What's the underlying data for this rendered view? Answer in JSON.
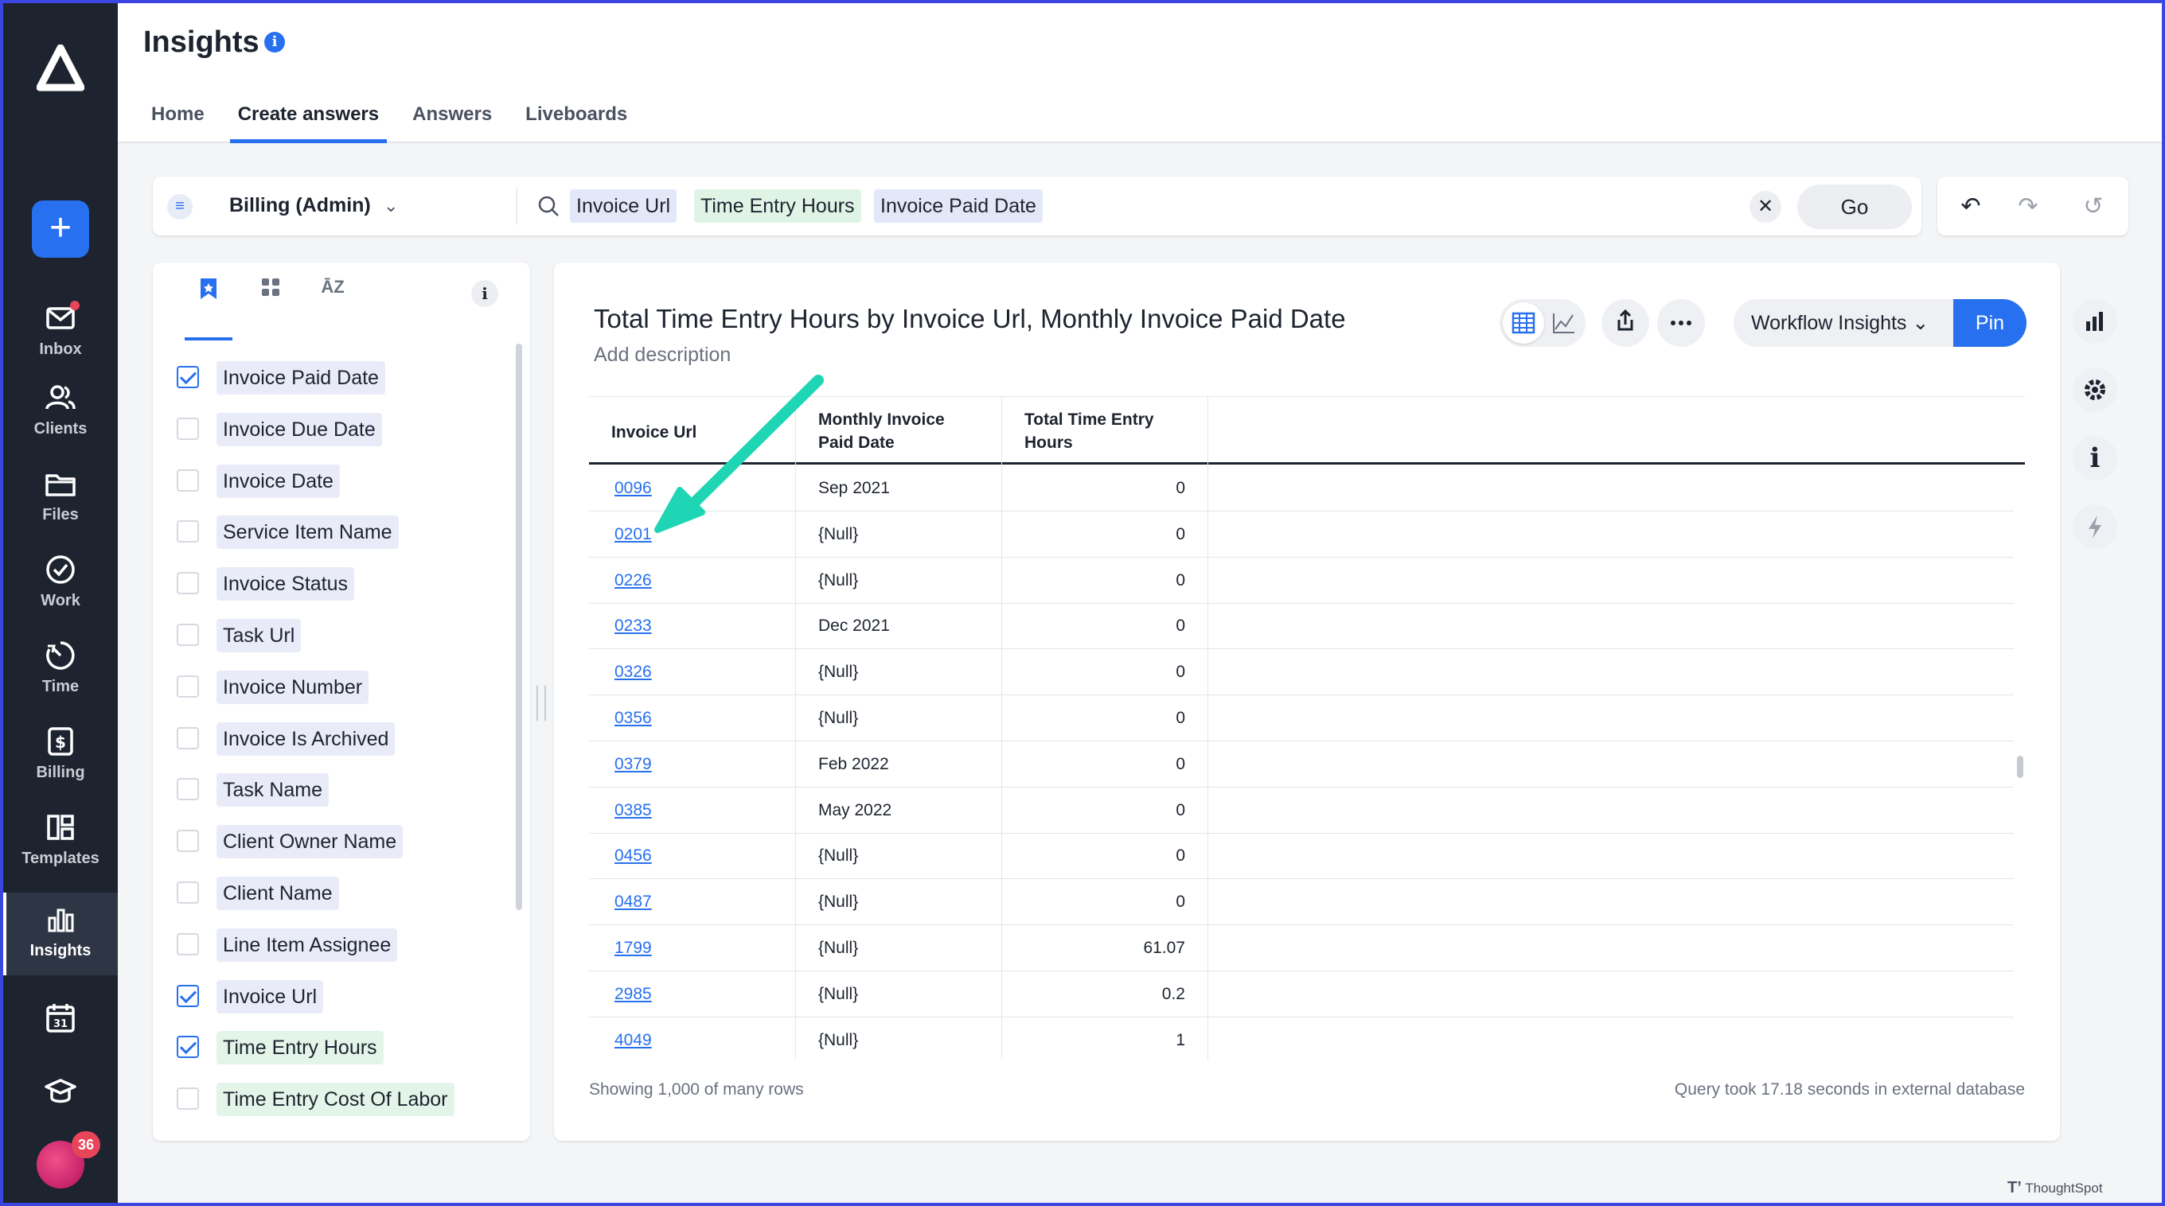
{
  "app": {
    "title": "Insights",
    "brand": "ThoughtSpot"
  },
  "nav": {
    "items": [
      {
        "label": "Inbox"
      },
      {
        "label": "Clients"
      },
      {
        "label": "Files"
      },
      {
        "label": "Work"
      },
      {
        "label": "Time"
      },
      {
        "label": "Billing"
      },
      {
        "label": "Templates"
      },
      {
        "label": "Insights"
      }
    ],
    "avatar_badge": "36"
  },
  "tabs": [
    "Home",
    "Create answers",
    "Answers",
    "Liveboards"
  ],
  "search": {
    "datasource": "Billing (Admin)",
    "tokens": [
      "Invoice Url",
      "Time Entry Hours",
      "Invoice Paid Date"
    ],
    "go_label": "Go"
  },
  "data_panel": {
    "columns": [
      {
        "label": "Invoice Paid Date",
        "checked": true,
        "kind": "attr"
      },
      {
        "label": "Invoice Due Date",
        "checked": false,
        "kind": "attr"
      },
      {
        "label": "Invoice Date",
        "checked": false,
        "kind": "attr"
      },
      {
        "label": "Service Item Name",
        "checked": false,
        "kind": "attr"
      },
      {
        "label": "Invoice Status",
        "checked": false,
        "kind": "attr"
      },
      {
        "label": "Task Url",
        "checked": false,
        "kind": "attr"
      },
      {
        "label": "Invoice Number",
        "checked": false,
        "kind": "attr"
      },
      {
        "label": "Invoice Is Archived",
        "checked": false,
        "kind": "attr"
      },
      {
        "label": "Task Name",
        "checked": false,
        "kind": "attr"
      },
      {
        "label": "Client Owner Name",
        "checked": false,
        "kind": "attr"
      },
      {
        "label": "Client Name",
        "checked": false,
        "kind": "attr"
      },
      {
        "label": "Line Item Assignee",
        "checked": false,
        "kind": "attr"
      },
      {
        "label": "Invoice Url",
        "checked": true,
        "kind": "attr"
      },
      {
        "label": "Time Entry Hours",
        "checked": true,
        "kind": "measure"
      },
      {
        "label": "Time Entry Cost Of Labor",
        "checked": false,
        "kind": "measure"
      }
    ]
  },
  "answer": {
    "title": "Total Time Entry Hours by Invoice Url, Monthly Invoice Paid Date",
    "description_placeholder": "Add description",
    "workflow_label": "Workflow Insights",
    "pin_label": "Pin",
    "table": {
      "headers": [
        "Invoice Url",
        "Monthly Invoice Paid Date",
        "Total Time Entry Hours"
      ],
      "rows": [
        [
          "0096",
          "Sep 2021",
          "0"
        ],
        [
          "0201",
          "{Null}",
          "0"
        ],
        [
          "0226",
          "{Null}",
          "0"
        ],
        [
          "0233",
          "Dec 2021",
          "0"
        ],
        [
          "0326",
          "{Null}",
          "0"
        ],
        [
          "0356",
          "{Null}",
          "0"
        ],
        [
          "0379",
          "Feb 2022",
          "0"
        ],
        [
          "0385",
          "May 2022",
          "0"
        ],
        [
          "0456",
          "{Null}",
          "0"
        ],
        [
          "0487",
          "{Null}",
          "0"
        ],
        [
          "1799",
          "{Null}",
          "61.07"
        ],
        [
          "2985",
          "{Null}",
          "0.2"
        ],
        [
          "4049",
          "{Null}",
          "1"
        ]
      ]
    },
    "footer_left": "Showing 1,000 of many rows",
    "footer_right": "Query took 17.18 seconds in external database"
  },
  "colors": {
    "accent": "#2770ef",
    "nav_bg": "#1d232f",
    "annotation_arrow": "#1fd6b4"
  }
}
